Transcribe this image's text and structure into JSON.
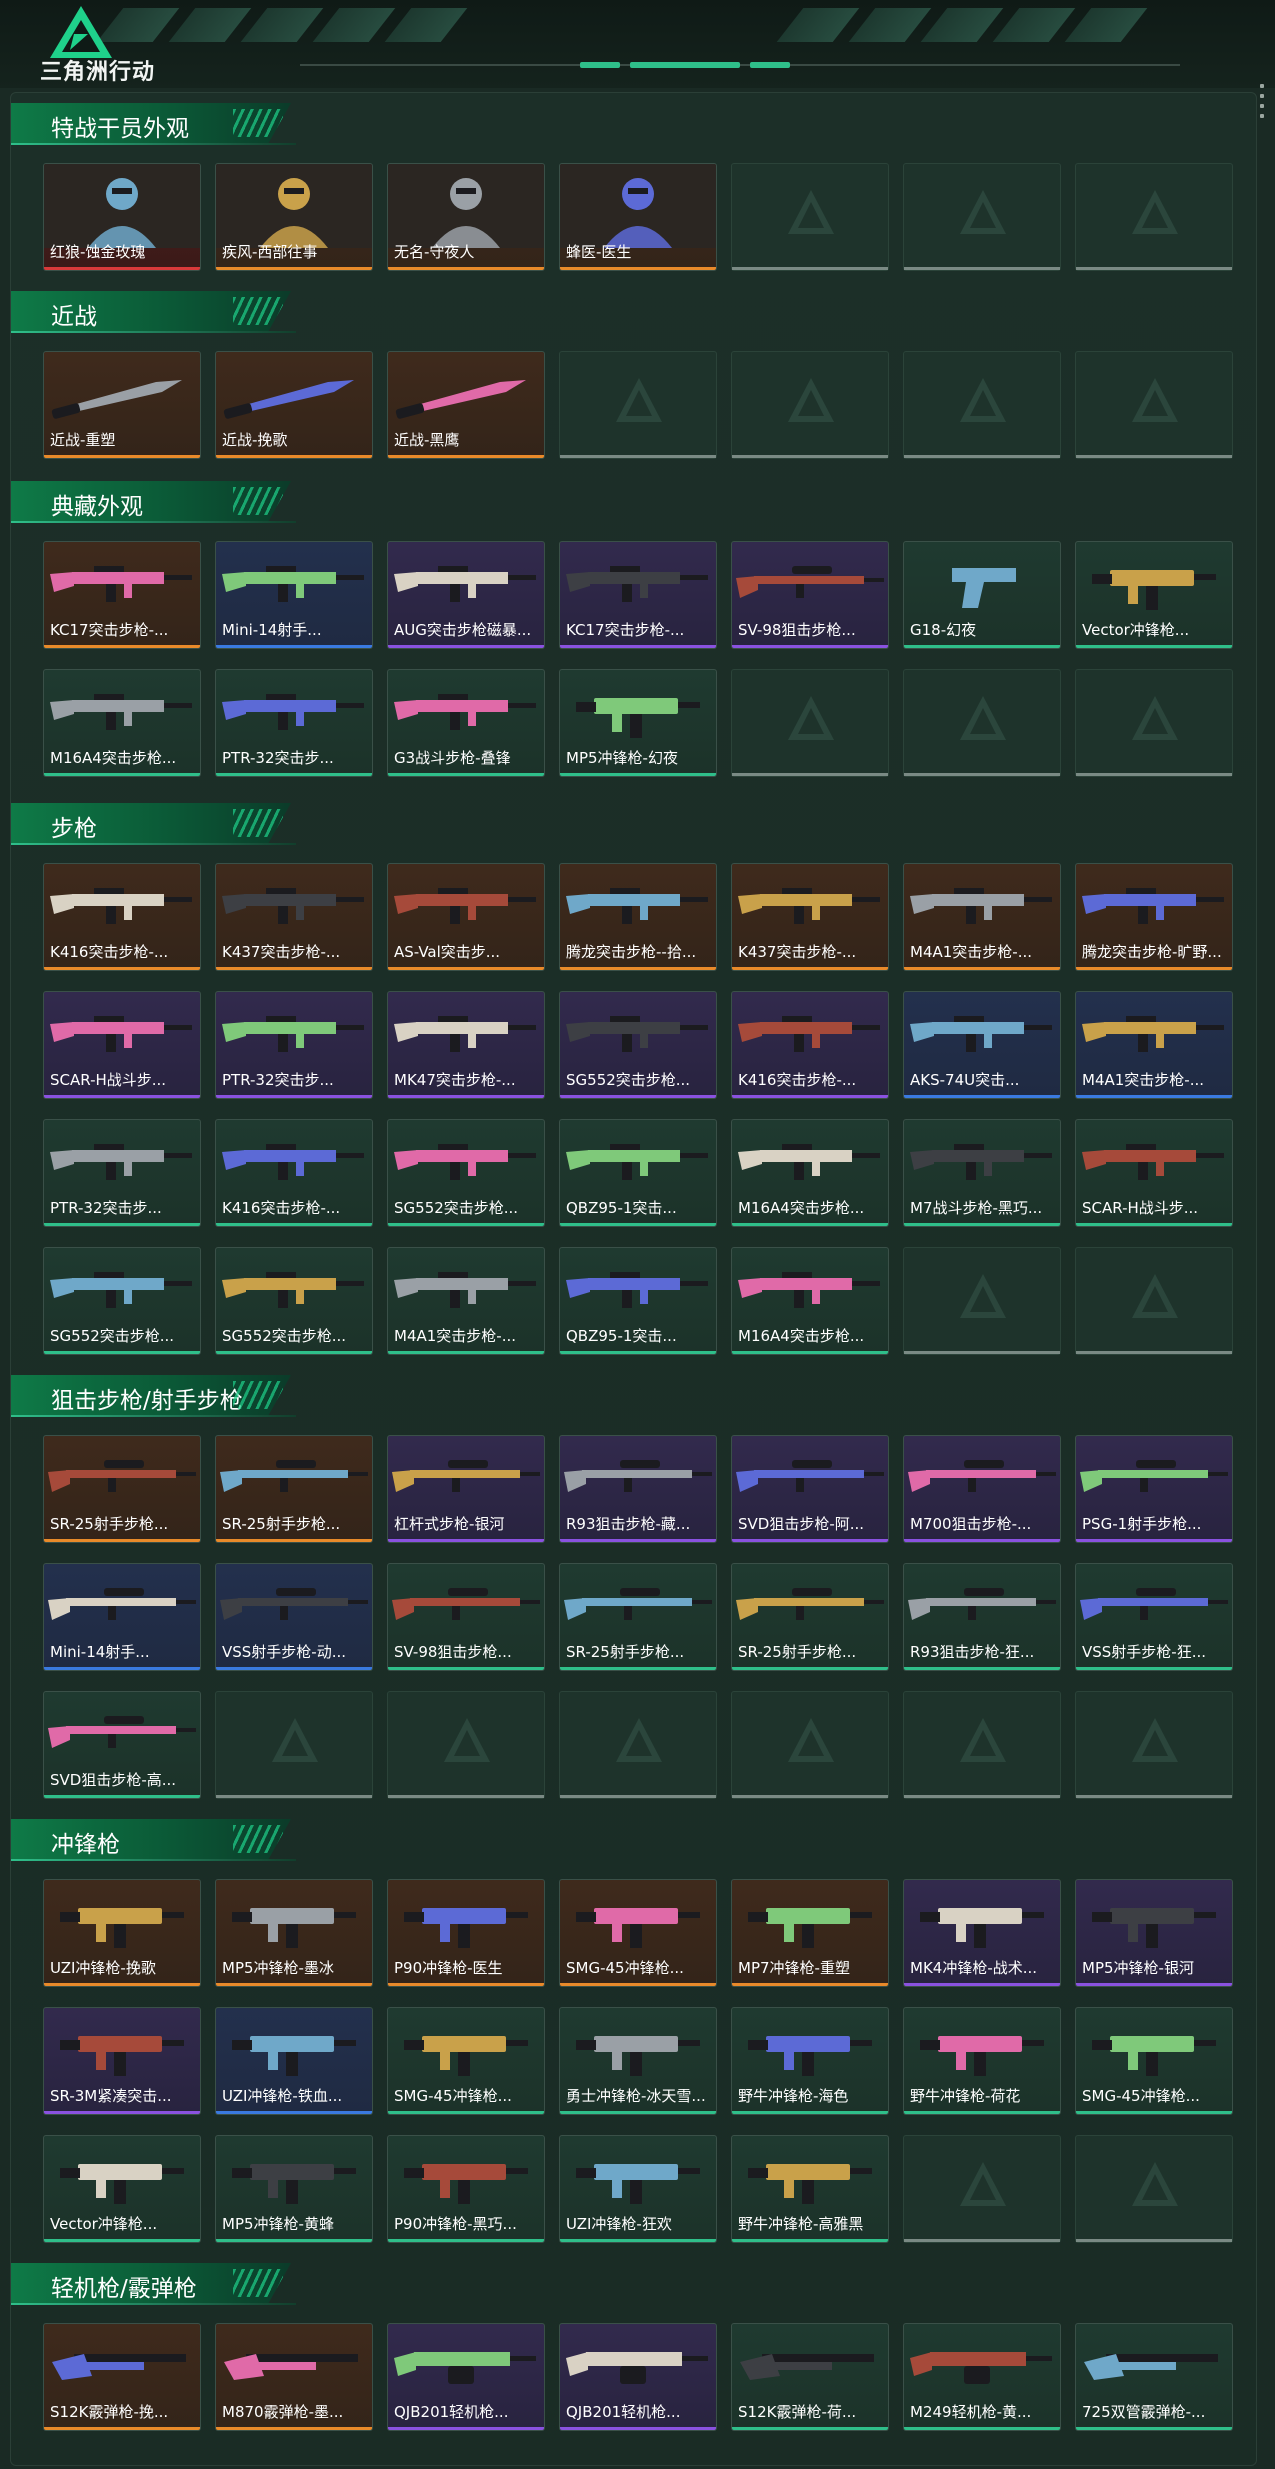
{
  "app": {
    "title": "三角洲行动"
  },
  "colors": {
    "accent": "#2fbf8a",
    "rarity": {
      "red": "#d93a3a",
      "orange": "#e98a2a",
      "purple": "#8a52e0",
      "blue": "#3a7ae0",
      "green": "#2fbf8a"
    }
  },
  "sections": [
    {
      "title": "特战干员外观",
      "rows": [
        [
          {
            "name": "红狼-蚀金玫瑰",
            "rarity": "red",
            "icon": "operator-portrait-icon"
          },
          {
            "name": "疾风-西部往事",
            "rarity": "orange",
            "icon": "operator-portrait-icon"
          },
          {
            "name": "无名-守夜人",
            "rarity": "orange",
            "icon": "operator-portrait-icon"
          },
          {
            "name": "蜂医-医生",
            "rarity": "orange",
            "icon": "operator-portrait-icon"
          },
          null,
          null,
          null
        ]
      ]
    },
    {
      "title": "近战",
      "rows": [
        [
          {
            "name": "近战-重塑",
            "rarity": "orange",
            "icon": "knife-icon"
          },
          {
            "name": "近战-挽歌",
            "rarity": "orange",
            "icon": "knife-icon"
          },
          {
            "name": "近战-黑鹰",
            "rarity": "orange",
            "icon": "knife-icon"
          },
          null,
          null,
          null,
          null
        ]
      ]
    },
    {
      "title": "典藏外观",
      "rows": [
        [
          {
            "name": "KC17突击步枪-...",
            "rarity": "orange",
            "icon": "rifle-icon"
          },
          {
            "name": "Mini-14射手...",
            "rarity": "blue",
            "icon": "rifle-icon"
          },
          {
            "name": "AUG突击步枪磁暴...",
            "rarity": "purple",
            "icon": "rifle-icon"
          },
          {
            "name": "KC17突击步枪-...",
            "rarity": "purple",
            "icon": "rifle-icon"
          },
          {
            "name": "SV-98狙击步枪...",
            "rarity": "purple",
            "icon": "sniper-rifle-icon"
          },
          {
            "name": "G18-幻夜",
            "rarity": "green",
            "icon": "pistol-icon"
          },
          {
            "name": "Vector冲锋枪...",
            "rarity": "green",
            "icon": "smg-icon"
          }
        ],
        [
          {
            "name": "M16A4突击步枪...",
            "rarity": "green",
            "icon": "rifle-icon"
          },
          {
            "name": "PTR-32突击步...",
            "rarity": "green",
            "icon": "rifle-icon"
          },
          {
            "name": "G3战斗步枪-叠锋",
            "rarity": "green",
            "icon": "rifle-icon"
          },
          {
            "name": "MP5冲锋枪-幻夜",
            "rarity": "green",
            "icon": "smg-icon"
          },
          null,
          null,
          null
        ]
      ]
    },
    {
      "title": "步枪",
      "rows": [
        [
          {
            "name": "K416突击步枪-...",
            "rarity": "orange",
            "icon": "rifle-icon"
          },
          {
            "name": "K437突击步枪-...",
            "rarity": "orange",
            "icon": "rifle-icon"
          },
          {
            "name": "AS-Val突击步...",
            "rarity": "orange",
            "icon": "rifle-icon"
          },
          {
            "name": "腾龙突击步枪--拾...",
            "rarity": "orange",
            "icon": "rifle-icon"
          },
          {
            "name": "K437突击步枪-...",
            "rarity": "orange",
            "icon": "rifle-icon"
          },
          {
            "name": "M4A1突击步枪-...",
            "rarity": "orange",
            "icon": "rifle-icon"
          },
          {
            "name": "腾龙突击步枪-旷野...",
            "rarity": "orange",
            "icon": "rifle-icon"
          }
        ],
        [
          {
            "name": "SCAR-H战斗步...",
            "rarity": "purple",
            "icon": "rifle-icon"
          },
          {
            "name": "PTR-32突击步...",
            "rarity": "purple",
            "icon": "rifle-icon"
          },
          {
            "name": "MK47突击步枪-...",
            "rarity": "purple",
            "icon": "rifle-icon"
          },
          {
            "name": "SG552突击步枪...",
            "rarity": "purple",
            "icon": "rifle-icon"
          },
          {
            "name": "K416突击步枪-...",
            "rarity": "purple",
            "icon": "rifle-icon"
          },
          {
            "name": "AKS-74U突击...",
            "rarity": "blue",
            "icon": "rifle-icon"
          },
          {
            "name": "M4A1突击步枪-...",
            "rarity": "blue",
            "icon": "rifle-icon"
          }
        ],
        [
          {
            "name": "PTR-32突击步...",
            "rarity": "green",
            "icon": "rifle-icon"
          },
          {
            "name": "K416突击步枪-...",
            "rarity": "green",
            "icon": "rifle-icon"
          },
          {
            "name": "SG552突击步枪...",
            "rarity": "green",
            "icon": "rifle-icon"
          },
          {
            "name": "QBZ95-1突击...",
            "rarity": "green",
            "icon": "rifle-icon"
          },
          {
            "name": "M16A4突击步枪...",
            "rarity": "green",
            "icon": "rifle-icon"
          },
          {
            "name": "M7战斗步枪-黑巧...",
            "rarity": "green",
            "icon": "rifle-icon"
          },
          {
            "name": "SCAR-H战斗步...",
            "rarity": "green",
            "icon": "rifle-icon"
          }
        ],
        [
          {
            "name": "SG552突击步枪...",
            "rarity": "green",
            "icon": "rifle-icon"
          },
          {
            "name": "SG552突击步枪...",
            "rarity": "green",
            "icon": "rifle-icon"
          },
          {
            "name": "M4A1突击步枪-...",
            "rarity": "green",
            "icon": "rifle-icon"
          },
          {
            "name": "QBZ95-1突击...",
            "rarity": "green",
            "icon": "rifle-icon"
          },
          {
            "name": "M16A4突击步枪...",
            "rarity": "green",
            "icon": "rifle-icon"
          },
          null,
          null
        ]
      ]
    },
    {
      "title": "狙击步枪/射手步枪",
      "rows": [
        [
          {
            "name": "SR-25射手步枪...",
            "rarity": "orange",
            "icon": "sniper-rifle-icon"
          },
          {
            "name": "SR-25射手步枪...",
            "rarity": "orange",
            "icon": "sniper-rifle-icon"
          },
          {
            "name": "杠杆式步枪-银河",
            "rarity": "purple",
            "icon": "sniper-rifle-icon"
          },
          {
            "name": "R93狙击步枪-藏...",
            "rarity": "purple",
            "icon": "sniper-rifle-icon"
          },
          {
            "name": "SVD狙击步枪-阿...",
            "rarity": "purple",
            "icon": "sniper-rifle-icon"
          },
          {
            "name": "M700狙击步枪-...",
            "rarity": "purple",
            "icon": "sniper-rifle-icon"
          },
          {
            "name": "PSG-1射手步枪...",
            "rarity": "purple",
            "icon": "sniper-rifle-icon"
          }
        ],
        [
          {
            "name": "Mini-14射手...",
            "rarity": "blue",
            "icon": "sniper-rifle-icon"
          },
          {
            "name": "VSS射手步枪-动...",
            "rarity": "blue",
            "icon": "sniper-rifle-icon"
          },
          {
            "name": "SV-98狙击步枪...",
            "rarity": "green",
            "icon": "sniper-rifle-icon"
          },
          {
            "name": "SR-25射手步枪...",
            "rarity": "green",
            "icon": "sniper-rifle-icon"
          },
          {
            "name": "SR-25射手步枪...",
            "rarity": "green",
            "icon": "sniper-rifle-icon"
          },
          {
            "name": "R93狙击步枪-狂...",
            "rarity": "green",
            "icon": "sniper-rifle-icon"
          },
          {
            "name": "VSS射手步枪-狂...",
            "rarity": "green",
            "icon": "sniper-rifle-icon"
          }
        ],
        [
          {
            "name": "SVD狙击步枪-高...",
            "rarity": "green",
            "icon": "sniper-rifle-icon"
          },
          null,
          null,
          null,
          null,
          null,
          null
        ]
      ]
    },
    {
      "title": "冲锋枪",
      "rows": [
        [
          {
            "name": "UZI冲锋枪-挽歌",
            "rarity": "orange",
            "icon": "smg-icon"
          },
          {
            "name": "MP5冲锋枪-墨冰",
            "rarity": "orange",
            "icon": "smg-icon"
          },
          {
            "name": "P90冲锋枪-医生",
            "rarity": "orange",
            "icon": "smg-icon"
          },
          {
            "name": "SMG-45冲锋枪...",
            "rarity": "orange",
            "icon": "smg-icon"
          },
          {
            "name": "MP7冲锋枪-重塑",
            "rarity": "orange",
            "icon": "smg-icon"
          },
          {
            "name": "MK4冲锋枪-战术...",
            "rarity": "purple",
            "icon": "smg-icon"
          },
          {
            "name": "MP5冲锋枪-银河",
            "rarity": "purple",
            "icon": "smg-icon"
          }
        ],
        [
          {
            "name": "SR-3M紧凑突击...",
            "rarity": "purple",
            "icon": "smg-icon"
          },
          {
            "name": "UZI冲锋枪-铁血...",
            "rarity": "blue",
            "icon": "smg-icon"
          },
          {
            "name": "SMG-45冲锋枪...",
            "rarity": "green",
            "icon": "smg-icon"
          },
          {
            "name": "勇士冲锋枪-冰天雪...",
            "rarity": "green",
            "icon": "smg-icon"
          },
          {
            "name": "野牛冲锋枪-海色",
            "rarity": "green",
            "icon": "smg-icon"
          },
          {
            "name": "野牛冲锋枪-荷花",
            "rarity": "green",
            "icon": "smg-icon"
          },
          {
            "name": "SMG-45冲锋枪...",
            "rarity": "green",
            "icon": "smg-icon"
          }
        ],
        [
          {
            "name": "Vector冲锋枪...",
            "rarity": "green",
            "icon": "smg-icon"
          },
          {
            "name": "MP5冲锋枪-黄蜂",
            "rarity": "green",
            "icon": "smg-icon"
          },
          {
            "name": "P90冲锋枪-黑巧...",
            "rarity": "green",
            "icon": "smg-icon"
          },
          {
            "name": "UZI冲锋枪-狂欢",
            "rarity": "green",
            "icon": "smg-icon"
          },
          {
            "name": "野牛冲锋枪-高雅黑",
            "rarity": "green",
            "icon": "smg-icon"
          },
          null,
          null
        ]
      ]
    },
    {
      "title": "轻机枪/霰弹枪",
      "rows": [
        [
          {
            "name": "S12K霰弹枪-挽...",
            "rarity": "orange",
            "icon": "shotgun-icon"
          },
          {
            "name": "M870霰弹枪-墨...",
            "rarity": "orange",
            "icon": "shotgun-icon"
          },
          {
            "name": "QJB201轻机枪...",
            "rarity": "purple",
            "icon": "lmg-icon"
          },
          {
            "name": "QJB201轻机枪...",
            "rarity": "purple",
            "icon": "lmg-icon"
          },
          {
            "name": "S12K霰弹枪-荷...",
            "rarity": "green",
            "icon": "shotgun-icon"
          },
          {
            "name": "M249轻机枪-黄...",
            "rarity": "green",
            "icon": "lmg-icon"
          },
          {
            "name": "725双管霰弹枪-...",
            "rarity": "green",
            "icon": "shotgun-icon"
          }
        ]
      ]
    }
  ]
}
